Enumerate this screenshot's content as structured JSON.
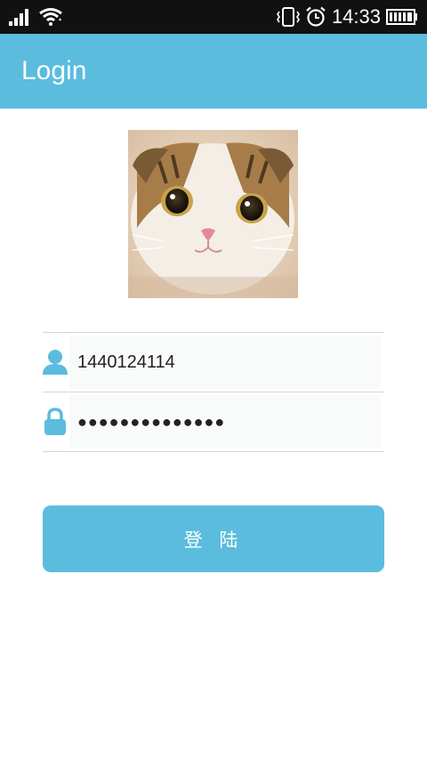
{
  "status_bar": {
    "time": "14:33",
    "icons": [
      "signal-icon",
      "wifi-icon",
      "vibrate-icon",
      "alarm-icon",
      "battery-icon"
    ]
  },
  "app_bar": {
    "title": "Login"
  },
  "avatar": {
    "icon": "cat-photo-avatar"
  },
  "form": {
    "username": {
      "value": "1440124114",
      "icon": "user-icon"
    },
    "password": {
      "value": "●●●●●●●●●●●●●●",
      "icon": "lock-icon"
    }
  },
  "login_button": {
    "label": "登 陆"
  },
  "colors": {
    "accent": "#5bbcde",
    "status_bar": "#111111",
    "divider": "#d6d6d6"
  }
}
